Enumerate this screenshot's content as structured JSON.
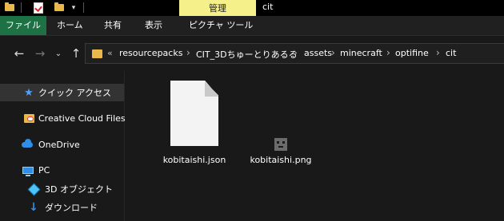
{
  "window": {
    "context_tab": "管理",
    "title": "cit"
  },
  "ribbon": {
    "tabs": [
      "ファイル",
      "ホーム",
      "共有",
      "表示",
      "ピクチャ ツール"
    ]
  },
  "address": {
    "overflow": "«",
    "crumbs": [
      "resourcepacks",
      "CIT_3Dちゅーとりあるる",
      "assets",
      "minecraft",
      "optifine",
      "cit"
    ],
    "separator": "›"
  },
  "nav": {
    "items": [
      {
        "label": "クイック アクセス",
        "icon": "star-icon"
      },
      {
        "label": "Creative Cloud Files",
        "icon": "creative-cloud-folder-icon"
      },
      {
        "label": "OneDrive",
        "icon": "onedrive-cloud-icon"
      },
      {
        "label": "PC",
        "icon": "pc-icon"
      },
      {
        "label": "3D オブジェクト",
        "icon": "3d-objects-icon"
      },
      {
        "label": "ダウンロード",
        "icon": "download-icon"
      }
    ]
  },
  "files": [
    {
      "name": "kobitaishi.json",
      "icon": "json-file-icon"
    },
    {
      "name": "kobitaishi.png",
      "icon": "png-thumbnail-icon"
    }
  ],
  "colors": {
    "file_tab": "#1e7145",
    "context_tab": "#f5f08a",
    "folder": "#e8b94a",
    "accent": "#2f8ee8"
  }
}
